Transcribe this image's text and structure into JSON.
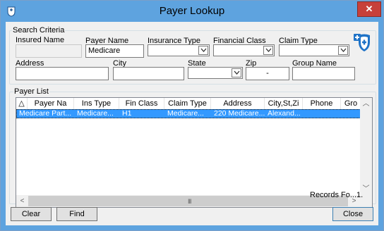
{
  "window": {
    "title": "Payer Lookup",
    "close_glyph": "✕"
  },
  "search": {
    "group_label": "Search Criteria",
    "insured_name_label": "Insured Name",
    "insured_name_value": "",
    "payer_name_label": "Payer Name",
    "payer_name_value": "Medicare",
    "insurance_type_label": "Insurance Type",
    "insurance_type_value": "",
    "financial_class_label": "Financial Class",
    "financial_class_value": "",
    "claim_type_label": "Claim Type",
    "claim_type_value": "",
    "address_label": "Address",
    "address_value": "",
    "city_label": "City",
    "city_value": "",
    "state_label": "State",
    "state_value": "",
    "zip_label": "Zip",
    "zip_value": "-",
    "group_name_label": "Group Name",
    "group_name_value": ""
  },
  "list": {
    "group_label": "Payer List",
    "sort_glyph": "△",
    "columns": [
      "Payer Na",
      "Ins Type",
      "Fin Class",
      "Claim Type",
      "Address",
      "City,St,Zi",
      "Phone",
      "Gro"
    ],
    "rows": [
      [
        "Medicare  Part...",
        "Medicare...",
        "H1",
        "Medicare...",
        "220  Medicare...",
        "Alexand...",
        "",
        ""
      ]
    ],
    "scroll_up": "︿",
    "scroll_down": "﹀",
    "scroll_left": "<",
    "scroll_right": ">",
    "grip": "III",
    "records_text": "Records Fo...1."
  },
  "buttons": {
    "clear": "Clear",
    "find": "Find",
    "close": "Close"
  },
  "colors": {
    "titlebar": "#5ea3df",
    "selection": "#3399ff",
    "close_button": "#c7403a",
    "shield": "#1f73c7"
  },
  "icons": [
    "app-icon",
    "close-icon",
    "payer-shield-icon",
    "sort-arrow-icon",
    "chevron-down-icon"
  ]
}
